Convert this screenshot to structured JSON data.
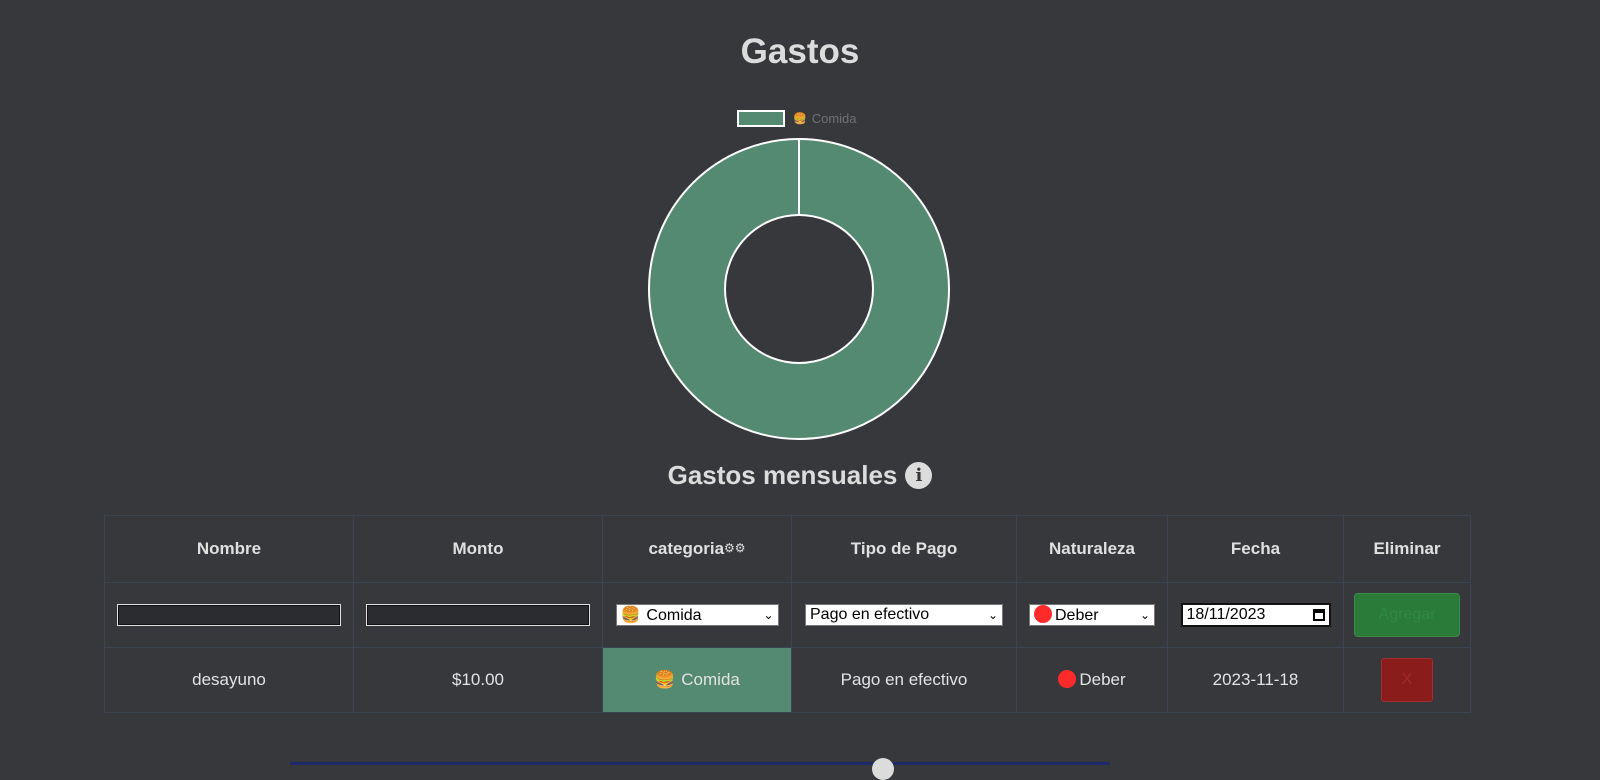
{
  "page": {
    "title": "Gastos",
    "section_title": "Gastos mensuales"
  },
  "chart_data": {
    "type": "pie",
    "categories": [
      "🍔 Comida"
    ],
    "values": [
      10
    ],
    "colors": [
      "#558a72"
    ],
    "legend": "top",
    "legend_label": "Comida",
    "legend_icon": "🍔"
  },
  "table": {
    "headers": {
      "nombre": "Nombre",
      "monto": "Monto",
      "categoria": "categoria",
      "tipo_pago": "Tipo de Pago",
      "naturaleza": "Naturaleza",
      "fecha": "Fecha",
      "eliminar": "Eliminar"
    },
    "form": {
      "nombre_value": "",
      "monto_value": "",
      "categoria_selected": "Comida",
      "categoria_icon": "🍔",
      "tipo_pago_selected": "Pago en efectivo",
      "naturaleza_selected": "Deber",
      "fecha_value": "18/11/2023",
      "add_label": "Agregar"
    },
    "rows": [
      {
        "nombre": "desayuno",
        "monto": "$10.00",
        "categoria": "Comida",
        "categoria_icon": "🍔",
        "tipo_pago": "Pago en efectivo",
        "naturaleza": "Deber",
        "fecha": "2023-11-18",
        "delete_label": "X"
      }
    ]
  },
  "colors": {
    "background": "#36383b",
    "category_comida": "#558a72",
    "add_button": "#2a7a3a",
    "delete_button": "#8a1c1c",
    "deber_dot": "#ff2a2a"
  },
  "icons": {
    "info": "info-icon",
    "gear": "gear-icon",
    "calendar": "calendar-icon",
    "chevron": "chevron-down-icon"
  }
}
